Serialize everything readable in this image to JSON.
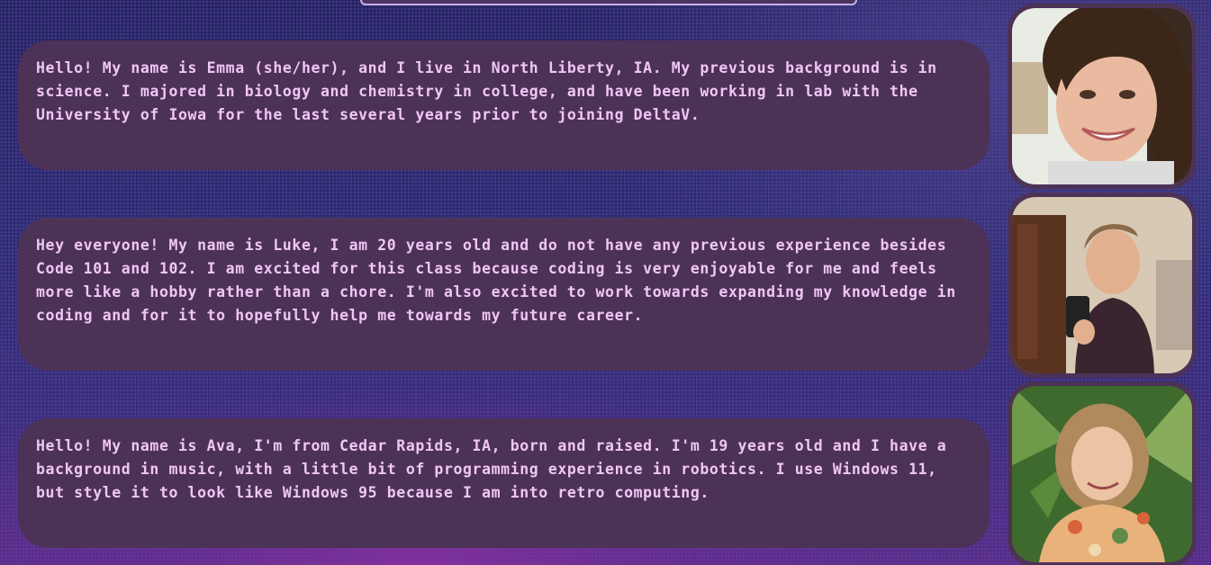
{
  "intros": [
    {
      "name": "Emma",
      "text": "Hello! My name is Emma (she/her), and I live in North Liberty, IA. My previous background is in science. I majored in biology and chemistry in college, and have been working in lab with the University of Iowa for the last several years prior to joining DeltaV."
    },
    {
      "name": "Luke",
      "text": "Hey everyone! My name is Luke, I am 20 years old and do not have any previous experience besides Code 101 and 102. I am excited for this class because coding is very enjoyable for me and feels more like a hobby rather than a chore. I'm also excited to work towards expanding my knowledge in coding and for it to hopefully help me towards my future career."
    },
    {
      "name": "Ava",
      "text": "Hello! My name is Ava, I'm from Cedar Rapids, IA, born and raised. I'm 19 years old and I have a background in music, with a little bit of programming experience in robotics. I use Windows 11, but style it to look like Windows 95 because I am into retro computing."
    }
  ],
  "colors": {
    "card_background": "#4c3256",
    "card_text": "#f0c7f4",
    "page_background": "#2a2a6a",
    "accent_pink": "#8a2a9a"
  }
}
